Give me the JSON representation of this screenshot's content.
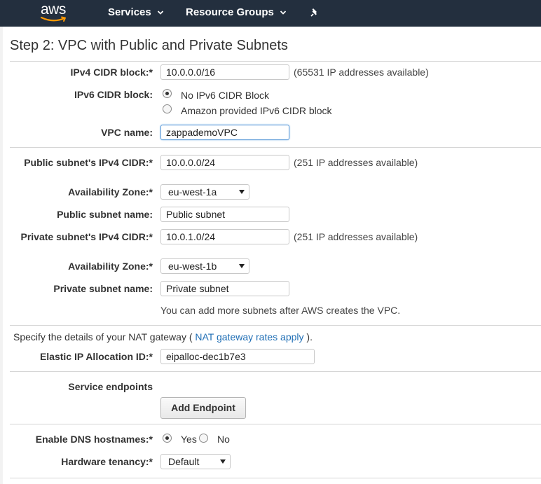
{
  "nav": {
    "logo": "aws",
    "services": "Services",
    "resource_groups": "Resource Groups",
    "bg_color": "#232f3e"
  },
  "page": {
    "title": "Step 2: VPC with Public and Private Subnets"
  },
  "vpc": {
    "ipv4_label": "IPv4 CIDR block:*",
    "ipv4_value": "10.0.0.0/16",
    "ipv4_note": "(65531 IP addresses available)",
    "ipv6_label": "IPv6 CIDR block:",
    "ipv6_option1": "No IPv6 CIDR Block",
    "ipv6_option2": "Amazon provided IPv6 CIDR block",
    "ipv6_selected": "No IPv6 CIDR Block",
    "name_label": "VPC name:",
    "name_value": "zappademoVPC"
  },
  "public_subnet": {
    "cidr_label": "Public subnet's IPv4 CIDR:*",
    "cidr_value": "10.0.0.0/24",
    "cidr_note": "(251 IP addresses available)",
    "az_label": "Availability Zone:*",
    "az_value": "eu-west-1a",
    "name_label": "Public subnet name:",
    "name_value": "Public subnet"
  },
  "private_subnet": {
    "cidr_label": "Private subnet's IPv4 CIDR:*",
    "cidr_value": "10.0.1.0/24",
    "cidr_note": "(251 IP addresses available)",
    "az_label": "Availability Zone:*",
    "az_value": "eu-west-1b",
    "name_label": "Private subnet name:",
    "name_value": "Private subnet"
  },
  "subnets_note": "You can add more subnets after AWS creates the VPC.",
  "nat": {
    "intro_prefix": "Specify the details of your NAT gateway (",
    "intro_link": "NAT gateway rates apply",
    "intro_suffix": ").",
    "eip_label": "Elastic IP Allocation ID:*",
    "eip_value": "eipalloc-dec1b7e3"
  },
  "endpoints": {
    "label": "Service endpoints",
    "button": "Add Endpoint"
  },
  "dns": {
    "label": "Enable DNS hostnames:*",
    "yes": "Yes",
    "no": "No",
    "selected": "Yes"
  },
  "tenancy": {
    "label": "Hardware tenancy:*",
    "value": "Default"
  }
}
